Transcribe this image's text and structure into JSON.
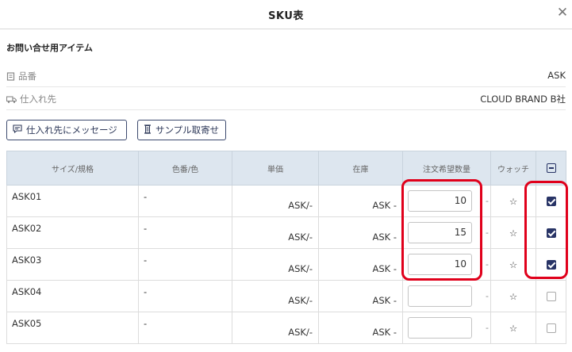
{
  "modal": {
    "title": "SKU表",
    "close_glyph": "✕"
  },
  "item": {
    "title": "お問い合せ用アイテム",
    "info": [
      {
        "label": "品番",
        "value": "ASK",
        "icon": "document-icon"
      },
      {
        "label": "仕入れ先",
        "value": "CLOUD BRAND B社",
        "icon": "truck-icon"
      }
    ]
  },
  "actions": {
    "message_label": "仕入れ先にメッセージ",
    "sample_label": "サンプル取寄せ"
  },
  "table": {
    "headers": [
      "サイズ/規格",
      "色番/色",
      "単価",
      "在庫",
      "注文希望数量",
      "ウォッチ"
    ],
    "rows": [
      {
        "size": "ASK01",
        "color": "-",
        "price": "ASK/-",
        "stock": "ASK -",
        "qty": "10",
        "qty_dash": "-",
        "watch": "☆",
        "checked": true
      },
      {
        "size": "ASK02",
        "color": "-",
        "price": "ASK/-",
        "stock": "ASK -",
        "qty": "15",
        "qty_dash": "-",
        "watch": "☆",
        "checked": true
      },
      {
        "size": "ASK03",
        "color": "-",
        "price": "ASK/-",
        "stock": "ASK -",
        "qty": "10",
        "qty_dash": "-",
        "watch": "☆",
        "checked": true
      },
      {
        "size": "ASK04",
        "color": "-",
        "price": "ASK/-",
        "stock": "ASK -",
        "qty": "",
        "qty_dash": "-",
        "watch": "☆",
        "checked": false
      },
      {
        "size": "ASK05",
        "color": "-",
        "price": "ASK/-",
        "stock": "ASK -",
        "qty": "",
        "qty_dash": "-",
        "watch": "☆",
        "checked": false
      }
    ]
  },
  "colors": {
    "accent": "#283466",
    "highlight": "#e0001b",
    "header_bg": "#dde6ef"
  }
}
